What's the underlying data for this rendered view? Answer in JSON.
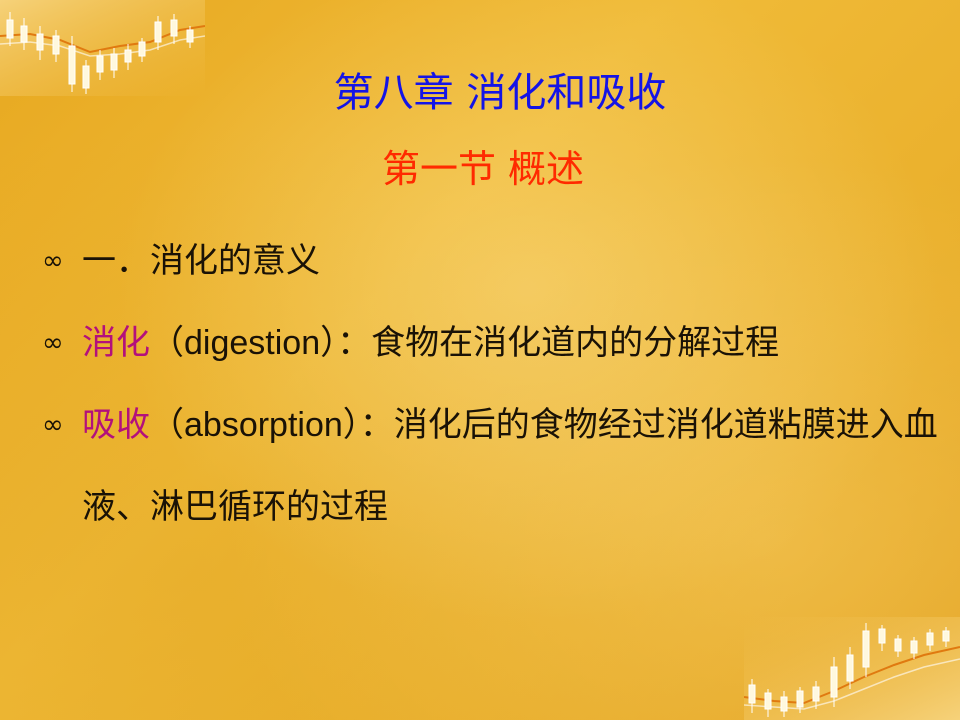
{
  "slide": {
    "title": "第八章  消化和吸收",
    "subtitle": "第一节  概述",
    "bullets": [
      {
        "text": "一．消化的意义"
      },
      {
        "term": "消化",
        "open": "（",
        "english": "digestion",
        "rest": "）：食物在消化道内的分解过程"
      },
      {
        "term": "吸收",
        "open": "（",
        "english": "absorption",
        "rest": "）：消化后的食物经过消化道粘膜进入血液、淋巴循环的过程"
      }
    ],
    "bullet_glyph": "∞"
  },
  "colors": {
    "title": "#1414e6",
    "subtitle": "#ff2a00",
    "term": "#b3107c",
    "body_text": "#1a1206",
    "background": "#eab02c"
  },
  "icons": {
    "bullet": "swirl-bullet-icon",
    "corner_top_left": "candlestick-chart-icon",
    "corner_bottom_right": "candlestick-chart-icon"
  }
}
